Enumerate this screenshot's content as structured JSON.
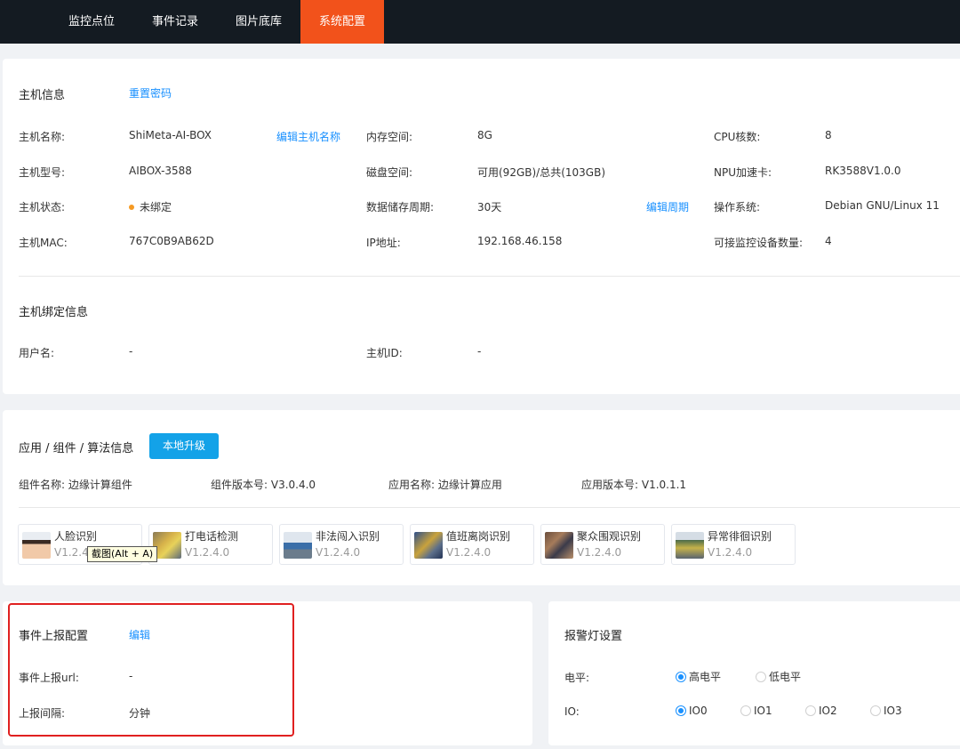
{
  "nav": {
    "items": [
      {
        "label": "监控点位",
        "active": false
      },
      {
        "label": "事件记录",
        "active": false
      },
      {
        "label": "图片底库",
        "active": false
      },
      {
        "label": "系统配置",
        "active": true
      }
    ]
  },
  "host": {
    "title": "主机信息",
    "reset_password": "重置密码",
    "fields": {
      "name_label": "主机名称:",
      "name_value": "ShiMeta-AI-BOX",
      "edit_name": "编辑主机名称",
      "memory_label": "内存空间:",
      "memory_value": "8G",
      "cpu_label": "CPU核数:",
      "cpu_value": "8",
      "model_label": "主机型号:",
      "model_value": "AIBOX-3588",
      "disk_label": "磁盘空间:",
      "disk_value": "可用(92GB)/总共(103GB)",
      "npu_label": "NPU加速卡:",
      "npu_value": "RK3588V1.0.0",
      "status_label": "主机状态:",
      "status_value": "未绑定",
      "retention_label": "数据储存周期:",
      "retention_value": "30天",
      "edit_retention": "编辑周期",
      "os_label": "操作系统:",
      "os_value": "Debian GNU/Linux 11",
      "mac_label": "主机MAC:",
      "mac_value": "767C0B9AB62D",
      "ip_label": "IP地址:",
      "ip_value": "192.168.46.158",
      "devices_label": "可接监控设备数量:",
      "devices_value": "4"
    },
    "binding": {
      "title": "主机绑定信息",
      "user_label": "用户名:",
      "user_value": "-",
      "hostid_label": "主机ID:",
      "hostid_value": "-"
    }
  },
  "apps": {
    "title": "应用 / 组件 / 算法信息",
    "upgrade_button": "本地升级",
    "component_name": "组件名称: 边缘计算组件",
    "component_version": "组件版本号: V3.0.4.0",
    "app_name": "应用名称: 边缘计算应用",
    "app_version": "应用版本号: V1.0.1.1",
    "algorithms": [
      {
        "name": "人脸识别",
        "version": "V1.2.4",
        "icon": "face-thumbnail"
      },
      {
        "name": "打电话检测",
        "version": "V1.2.4.0",
        "icon": "phone-call-thumbnail"
      },
      {
        "name": "非法闯入识别",
        "version": "V1.2.4.0",
        "icon": "intrusion-thumbnail"
      },
      {
        "name": "值班离岗识别",
        "version": "V1.2.4.0",
        "icon": "off-duty-thumbnail"
      },
      {
        "name": "聚众围观识别",
        "version": "V1.2.4.0",
        "icon": "crowd-thumbnail"
      },
      {
        "name": "异常徘徊识别",
        "version": "V1.2.4.0",
        "icon": "loitering-thumbnail"
      }
    ],
    "tooltip": "截图(Alt + A)"
  },
  "event_report": {
    "title": "事件上报配置",
    "edit": "编辑",
    "url_label": "事件上报url:",
    "url_value": "-",
    "interval_label": "上报间隔:",
    "interval_value": "分钟"
  },
  "alarm_light": {
    "title": "报警灯设置",
    "level_label": "电平:",
    "level_options": [
      {
        "label": "高电平",
        "selected": true
      },
      {
        "label": "低电平",
        "selected": false
      }
    ],
    "io_label": "IO:",
    "io_options": [
      {
        "label": "IO0",
        "selected": true
      },
      {
        "label": "IO1",
        "selected": false
      },
      {
        "label": "IO2",
        "selected": false
      },
      {
        "label": "IO3",
        "selected": false
      }
    ]
  },
  "colors": {
    "nav_bg": "#141b22",
    "nav_active": "#f2521b",
    "link": "#1890ff",
    "primary_button": "#13a2e8",
    "status_dot": "#f59a23",
    "highlight_border": "#e02020"
  }
}
